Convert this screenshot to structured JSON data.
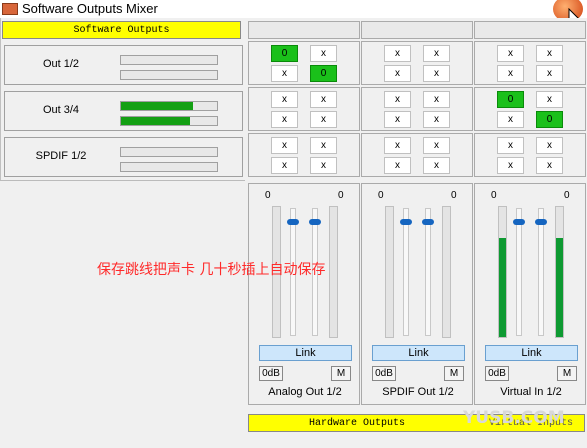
{
  "window": {
    "title": "Software Outputs Mixer"
  },
  "software_outputs": {
    "header": "Software Outputs",
    "rows": [
      {
        "label": "Out 1/2",
        "levels": [
          0,
          0
        ]
      },
      {
        "label": "Out 3/4",
        "levels": [
          0.75,
          0.72
        ]
      },
      {
        "label": "SPDIF 1/2",
        "levels": [
          0,
          0
        ]
      }
    ]
  },
  "columns": [
    {
      "name": "Analog Out 1/2",
      "matrix": [
        [
          [
            "0",
            "x"
          ],
          [
            "x",
            "0"
          ]
        ],
        [
          [
            "x",
            "x"
          ],
          [
            "x",
            "x"
          ]
        ],
        [
          [
            "x",
            "x"
          ],
          [
            "x",
            "x"
          ]
        ]
      ],
      "matrix_on": [
        [
          [
            true,
            false
          ],
          [
            false,
            true
          ]
        ],
        [
          [
            false,
            false
          ],
          [
            false,
            false
          ]
        ],
        [
          [
            false,
            false
          ],
          [
            false,
            false
          ]
        ]
      ],
      "db_left": "0",
      "db_right": "0",
      "meter_levels": [
        0,
        0
      ],
      "link_label": "Link",
      "zero_db_label": "0dB",
      "mute_label": "M"
    },
    {
      "name": "SPDIF Out 1/2",
      "matrix": [
        [
          [
            "x",
            "x"
          ],
          [
            "x",
            "x"
          ]
        ],
        [
          [
            "x",
            "x"
          ],
          [
            "x",
            "x"
          ]
        ],
        [
          [
            "x",
            "x"
          ],
          [
            "x",
            "x"
          ]
        ]
      ],
      "matrix_on": [
        [
          [
            false,
            false
          ],
          [
            false,
            false
          ]
        ],
        [
          [
            false,
            false
          ],
          [
            false,
            false
          ]
        ],
        [
          [
            false,
            false
          ],
          [
            false,
            false
          ]
        ]
      ],
      "db_left": "0",
      "db_right": "0",
      "meter_levels": [
        0,
        0
      ],
      "link_label": "Link",
      "zero_db_label": "0dB",
      "mute_label": "M"
    },
    {
      "name": "Virtual In 1/2",
      "matrix": [
        [
          [
            "x",
            "x"
          ],
          [
            "x",
            "x"
          ]
        ],
        [
          [
            "0",
            "x"
          ],
          [
            "x",
            "0"
          ]
        ],
        [
          [
            "x",
            "x"
          ],
          [
            "x",
            "x"
          ]
        ]
      ],
      "matrix_on": [
        [
          [
            false,
            false
          ],
          [
            false,
            false
          ]
        ],
        [
          [
            true,
            false
          ],
          [
            false,
            true
          ]
        ],
        [
          [
            false,
            false
          ],
          [
            false,
            false
          ]
        ]
      ],
      "db_left": "0",
      "db_right": "0",
      "meter_levels": [
        0.76,
        0.76
      ],
      "link_label": "Link",
      "zero_db_label": "0dB",
      "mute_label": "M"
    }
  ],
  "footer": {
    "hardware_outputs": "Hardware Outputs",
    "virtual_inputs": "Virtual Inputs"
  },
  "overlay_text": "保存跳线把声卡  几十秒插上自动保存",
  "watermark": "YUSB.COM",
  "colors": {
    "meter_green": "#14a014",
    "active_cell": "#1ac01a",
    "header_yellow": "#ffff00",
    "knob_blue": "#1565c0"
  }
}
